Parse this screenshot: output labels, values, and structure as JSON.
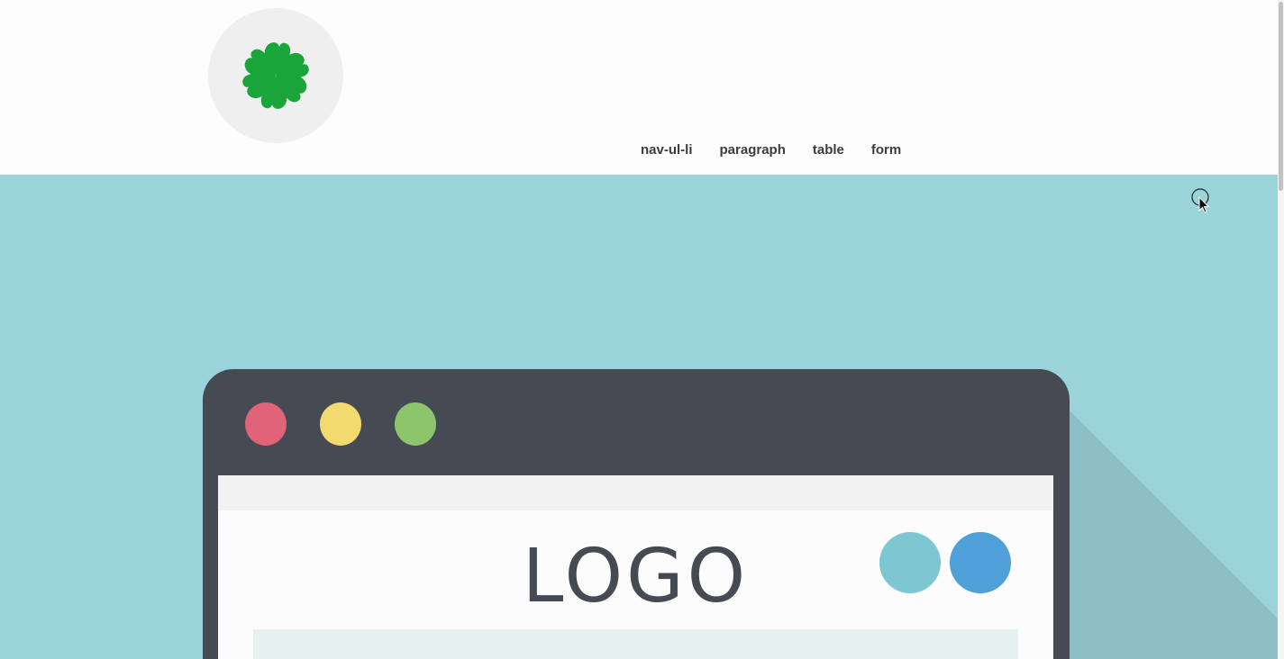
{
  "header": {
    "logo_icon": "clover-icon",
    "nav": [
      {
        "label": "nav-ul-li"
      },
      {
        "label": "paragraph"
      },
      {
        "label": "table"
      },
      {
        "label": "form"
      }
    ]
  },
  "hero": {
    "illustration": {
      "window_dots": [
        "red-dot",
        "yellow-dot",
        "green-dot"
      ],
      "logo_text": "LOGO"
    }
  },
  "colors": {
    "hero_bg": "#9bd3db",
    "browser_frame": "#454a53",
    "clover": "#1aa53a",
    "dot_red": "#e06377",
    "dot_yellow": "#f2da6e",
    "dot_green": "#8dc56c",
    "circle_teal": "#7cc7d2",
    "circle_blue": "#4f9fd8"
  }
}
